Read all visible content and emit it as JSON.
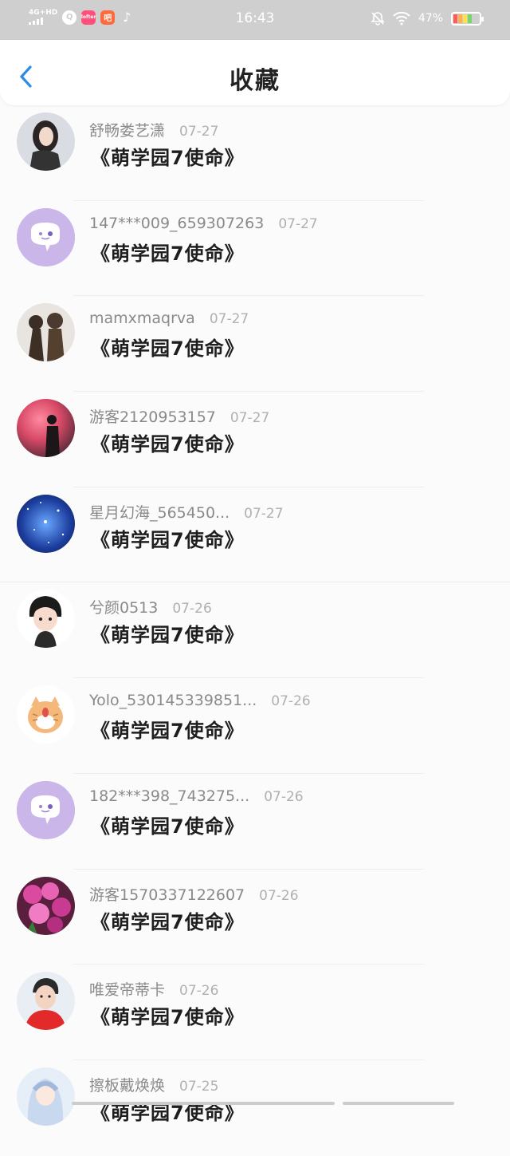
{
  "status_bar": {
    "network": "4G+HD",
    "time": "16:43",
    "battery": "47%",
    "apps": [
      {
        "name": "qq-browser-icon",
        "label": "Q",
        "bg": "#ffffff",
        "fg": "#cfcfcf"
      },
      {
        "name": "lofter-icon",
        "label": "lofter",
        "bg": "#ff4f7a",
        "fg": "#ffffff"
      },
      {
        "name": "app-icon",
        "label": "吧",
        "bg": "#ff6a3d",
        "fg": "#ffffff"
      },
      {
        "name": "tiktok-icon",
        "label": "♪",
        "bg": "transparent",
        "fg": "#ffffff"
      }
    ]
  },
  "header": {
    "back_icon": "chevron-left-icon",
    "title": "收藏",
    "accent": "#2a8ee6"
  },
  "items": [
    {
      "username": "舒畅娄艺潇",
      "date": "07-27",
      "title": "《萌学园7使命》",
      "avatar": "photo-woman"
    },
    {
      "username": "147***009_659307263",
      "date": "07-27",
      "title": "《萌学园7使命》",
      "avatar": "default"
    },
    {
      "username": "mamxmaqrva",
      "date": "07-27",
      "title": "《萌学园7使命》",
      "avatar": "photo-statue"
    },
    {
      "username": "游客2120953157",
      "date": "07-27",
      "title": "《萌学园7使命》",
      "avatar": "photo-smoke"
    },
    {
      "username": "星月幻海_565450...",
      "date": "07-27",
      "title": "《萌学园7使命》",
      "avatar": "photo-galaxy"
    },
    {
      "username": "兮颜0513",
      "date": "07-26",
      "title": "《萌学园7使命》",
      "avatar": "cartoon-boy"
    },
    {
      "username": "Yolo_530145339851...",
      "date": "07-26",
      "title": "《萌学园7使命》",
      "avatar": "cartoon-cat"
    },
    {
      "username": "182***398_743275...",
      "date": "07-26",
      "title": "《萌学园7使命》",
      "avatar": "default"
    },
    {
      "username": "游客1570337122607",
      "date": "07-26",
      "title": "《萌学园7使命》",
      "avatar": "photo-flowers"
    },
    {
      "username": "唯爱帝蒂卡",
      "date": "07-26",
      "title": "《萌学园7使命》",
      "avatar": "photo-man"
    },
    {
      "username": "擦板戴焕焕",
      "date": "07-25",
      "title": "《萌学园7使命》",
      "avatar": "photo-anime"
    }
  ]
}
